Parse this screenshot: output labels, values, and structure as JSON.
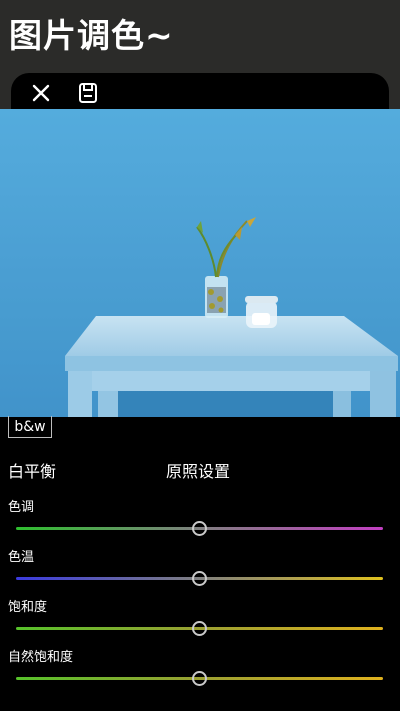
{
  "header": {
    "title": "图片调色~"
  },
  "toolbar": {
    "close_icon": "close-icon",
    "save_icon": "save-icon"
  },
  "filter": {
    "bw_label": "b&w"
  },
  "white_balance": {
    "label": "白平衡",
    "reset_label": "原照设置"
  },
  "sliders": [
    {
      "label": "色调",
      "value": 0.5,
      "gradient": [
        "#2fbf2f",
        "#808080",
        "#c23fc2"
      ]
    },
    {
      "label": "色温",
      "value": 0.5,
      "gradient": [
        "#3b3be0",
        "#808080",
        "#e0c21f"
      ]
    },
    {
      "label": "饱和度",
      "value": 0.5,
      "gradient": [
        "#57c22b",
        "#9aa032",
        "#e0b21f"
      ]
    },
    {
      "label": "自然饱和度",
      "value": 0.5,
      "gradient": [
        "#57c22b",
        "#9aa032",
        "#e0b21f"
      ]
    }
  ]
}
